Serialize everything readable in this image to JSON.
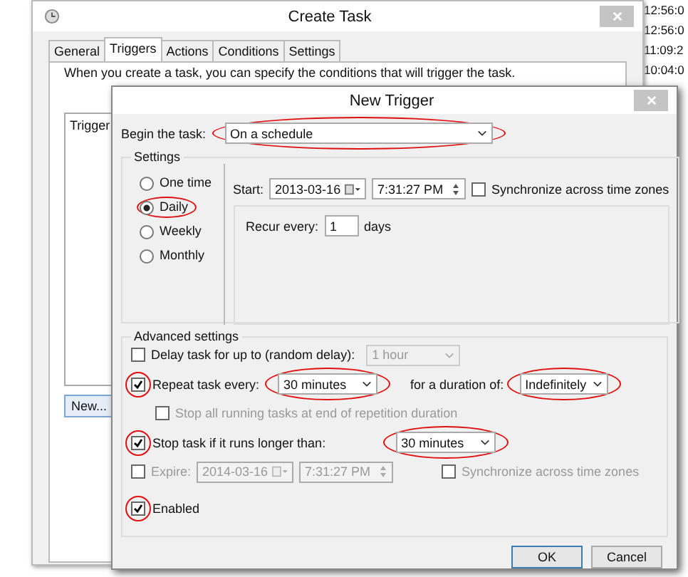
{
  "timestamps": [
    "12:56:0",
    "12:56:0",
    "11:09:2",
    "10:04:0"
  ],
  "create_task": {
    "title": "Create Task",
    "tabs": [
      {
        "label": "General",
        "selected": false
      },
      {
        "label": "Triggers",
        "selected": true
      },
      {
        "label": "Actions",
        "selected": false
      },
      {
        "label": "Conditions",
        "selected": false
      },
      {
        "label": "Settings",
        "selected": false
      }
    ],
    "description": "When you create a task, you can specify the conditions that will trigger the task.",
    "list_header": "Trigger",
    "new_button": "New..."
  },
  "new_trigger": {
    "title": "New Trigger",
    "begin_label": "Begin the task:",
    "begin_value": "On a schedule",
    "settings": {
      "legend": "Settings",
      "schedules": [
        {
          "label": "One time",
          "selected": false
        },
        {
          "label": "Daily",
          "selected": true
        },
        {
          "label": "Weekly",
          "selected": false
        },
        {
          "label": "Monthly",
          "selected": false
        }
      ],
      "start_label": "Start:",
      "start_date": "2013-03-16",
      "start_time": "7:31:27 PM",
      "sync": {
        "label": "Synchronize across time zones",
        "checked": false
      },
      "recur_label": "Recur every:",
      "recur_value": "1",
      "recur_unit": "days"
    },
    "advanced": {
      "legend": "Advanced settings",
      "delay": {
        "label": "Delay task for up to (random delay):",
        "checked": false,
        "value": "1 hour",
        "disabled": true
      },
      "repeat": {
        "label": "Repeat task every:",
        "checked": true,
        "value": "30 minutes",
        "duration_label": "for a duration of:",
        "duration_value": "Indefinitely"
      },
      "stop_all": {
        "label": "Stop all running tasks at end of repetition duration",
        "checked": false,
        "disabled": true
      },
      "stop_longer": {
        "label": "Stop task if it runs longer than:",
        "checked": true,
        "value": "30 minutes"
      },
      "expire": {
        "label": "Expire:",
        "checked": false,
        "date": "2014-03-16",
        "time": "7:31:27 PM",
        "disabled": true,
        "sync_label": "Synchronize across time zones",
        "sync_checked": false
      },
      "enabled": {
        "label": "Enabled",
        "checked": true
      }
    },
    "buttons": [
      "OK",
      "Cancel"
    ]
  }
}
